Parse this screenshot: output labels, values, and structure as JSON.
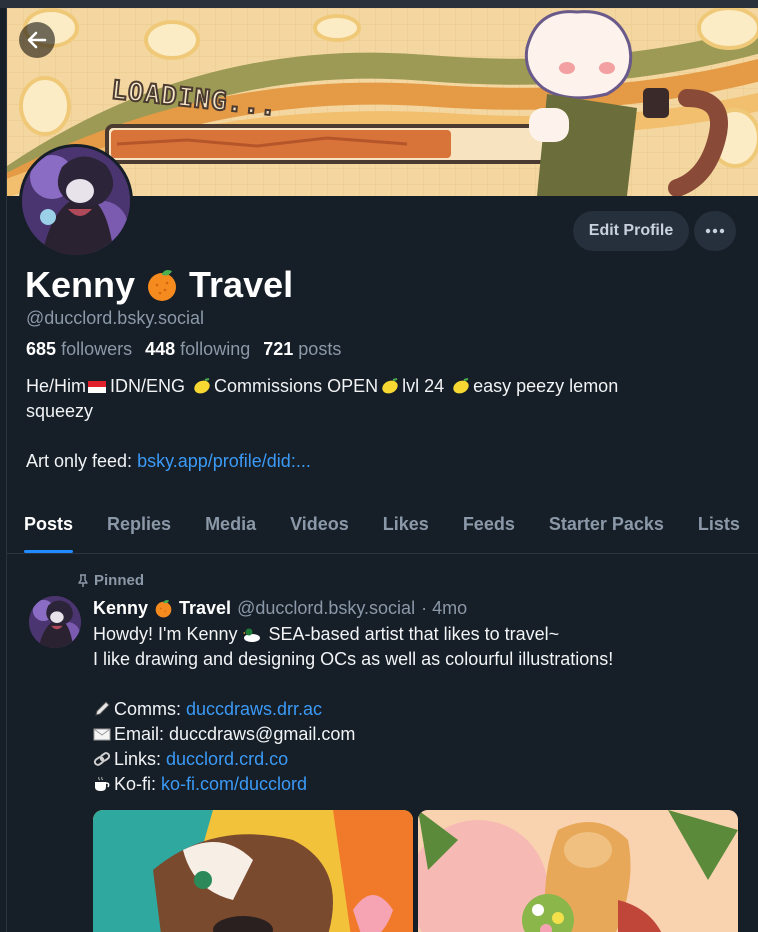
{
  "profile": {
    "display_name_part1": "Kenny",
    "display_name_part2": "Travel",
    "name_emoji": "orange-icon",
    "handle": "@ducclord.bsky.social",
    "banner_text": "LOADING...",
    "stats": {
      "followers_count": "685",
      "followers_label": "followers",
      "following_count": "448",
      "following_label": "following",
      "posts_count": "721",
      "posts_label": "posts"
    },
    "bio": {
      "seg1": "He/Him",
      "seg2": "IDN/ENG",
      "seg3": "Commissions OPEN",
      "seg4": "lvl 24",
      "seg5": "easy peezy lemon",
      "line2": "squeezy",
      "art_feed_label": "Art only feed: ",
      "art_feed_link": "bsky.app/profile/did:..."
    }
  },
  "actions": {
    "edit_profile": "Edit Profile"
  },
  "tabs": [
    "Posts",
    "Replies",
    "Media",
    "Videos",
    "Likes",
    "Feeds",
    "Starter Packs",
    "Lists"
  ],
  "active_tab": "Posts",
  "post": {
    "pinned_label": "Pinned",
    "author_part1": "Kenny",
    "author_part2": "Travel",
    "author_handle": "@ducclord.bsky.social",
    "timestamp": "· 4mo",
    "line1_a": "Howdy! I'm Kenny",
    "line1_b": "SEA-based artist that likes to travel~",
    "line2": "I like drawing and designing OCs as well as colourful illustrations!",
    "comms_label": "Comms: ",
    "comms_link": "duccdraws.drr.ac",
    "email_label": "Email: duccdraws@gmail.com",
    "links_label": "Links: ",
    "links_link": "ducclord.crd.co",
    "kofi_label": "Ko-fi: ",
    "kofi_link": "ko-fi.com/ducclord"
  },
  "colors": {
    "background": "#161e27",
    "accent": "#208bfe",
    "link": "#3b9af6",
    "muted": "#8b98a8"
  }
}
